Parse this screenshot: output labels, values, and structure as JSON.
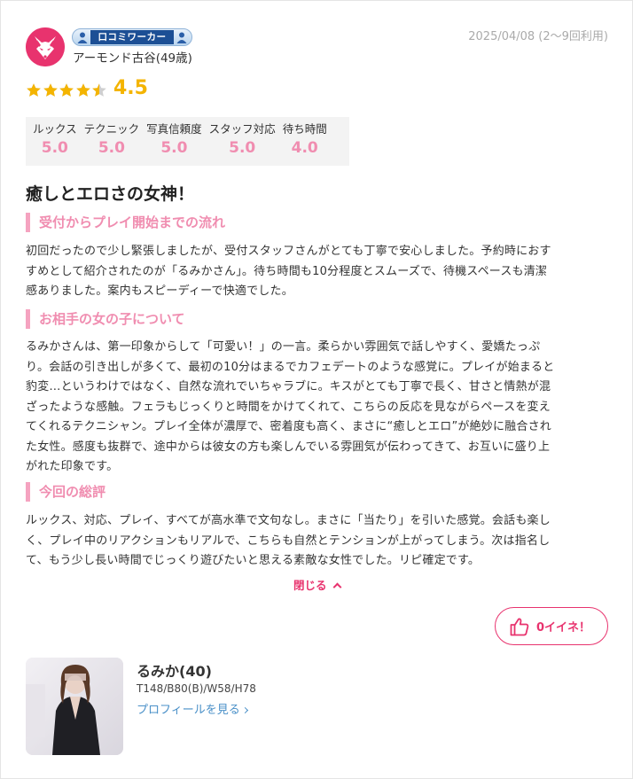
{
  "reviewer": {
    "badge_label": "口コミワーカー",
    "name": "アーモンド古谷(49歳)",
    "avatar_icon": "fox-mask-icon"
  },
  "review_meta": {
    "date": "2025/04/08 (2〜9回利用)"
  },
  "rating": {
    "value": 4.5,
    "display": "4.5",
    "max": 5,
    "star_color": "#f4b400"
  },
  "scores": [
    {
      "label": "ルックス",
      "value": "5.0"
    },
    {
      "label": "テクニック",
      "value": "5.0"
    },
    {
      "label": "写真信頼度",
      "value": "5.0"
    },
    {
      "label": "スタッフ対応",
      "value": "5.0"
    },
    {
      "label": "待ち時間",
      "value": "4.0"
    }
  ],
  "review": {
    "title": "癒しとエロさの女神！",
    "sections": [
      {
        "heading": "受付からプレイ開始までの流れ",
        "lines": [
          "初回だったので少し緊張しましたが、受付スタッフさんがとても丁寧で安心しました。予約時におす",
          "すめとして紹介されたのが「るみかさん」。待ち時間も10分程度とスムーズで、待機スペースも清潔",
          "感ありました。案内もスピーディーで快適でした。"
        ]
      },
      {
        "heading": "お相手の女の子について",
        "lines": [
          "るみかさんは、第一印象からして「可愛い！」の一言。柔らかい雰囲気で話しやすく、愛嬌たっぷ",
          "り。会話の引き出しが多くて、最初の10分はまるでカフェデートのような感覚に。プレイが始まると",
          "豹変…というわけではなく、自然な流れでいちゃラブに。キスがとても丁寧で長く、甘さと情熱が混",
          "ざったような感触。フェラもじっくりと時間をかけてくれて、こちらの反応を見ながらペースを変え",
          "てくれるテクニシャン。プレイ全体が濃厚で、密着度も高く、まさに“癒しとエロ”が絶妙に融合され",
          "た女性。感度も抜群で、途中からは彼女の方も楽しんでいる雰囲気が伝わってきて、お互いに盛り上",
          "がれた印象です。"
        ]
      },
      {
        "heading": "今回の総評",
        "lines": [
          "ルックス、対応、プレイ、すべてが高水準で文句なし。まさに「当たり」を引いた感覚。会話も楽し",
          "く、プレイ中のリアクションもリアルで、こちらも自然とテンションが上がってしまう。次は指名し",
          "て、もう少し長い時間でじっくり遊びたいと思える素敵な女性でした。リピ確定です。"
        ]
      }
    ],
    "close_label": "閉じる"
  },
  "like": {
    "label": "0イイネ！",
    "count": 0,
    "icon": "thumbs-up-icon",
    "accent_color": "#e8336e"
  },
  "girl": {
    "name": "るみか(40)",
    "specs": "T148/B80(B)/W58/H78",
    "profile_link": "プロフィールを見る"
  },
  "colors": {
    "accent_pink": "#e8336e",
    "light_pink": "#f08db0",
    "link_blue": "#4a90c8"
  }
}
